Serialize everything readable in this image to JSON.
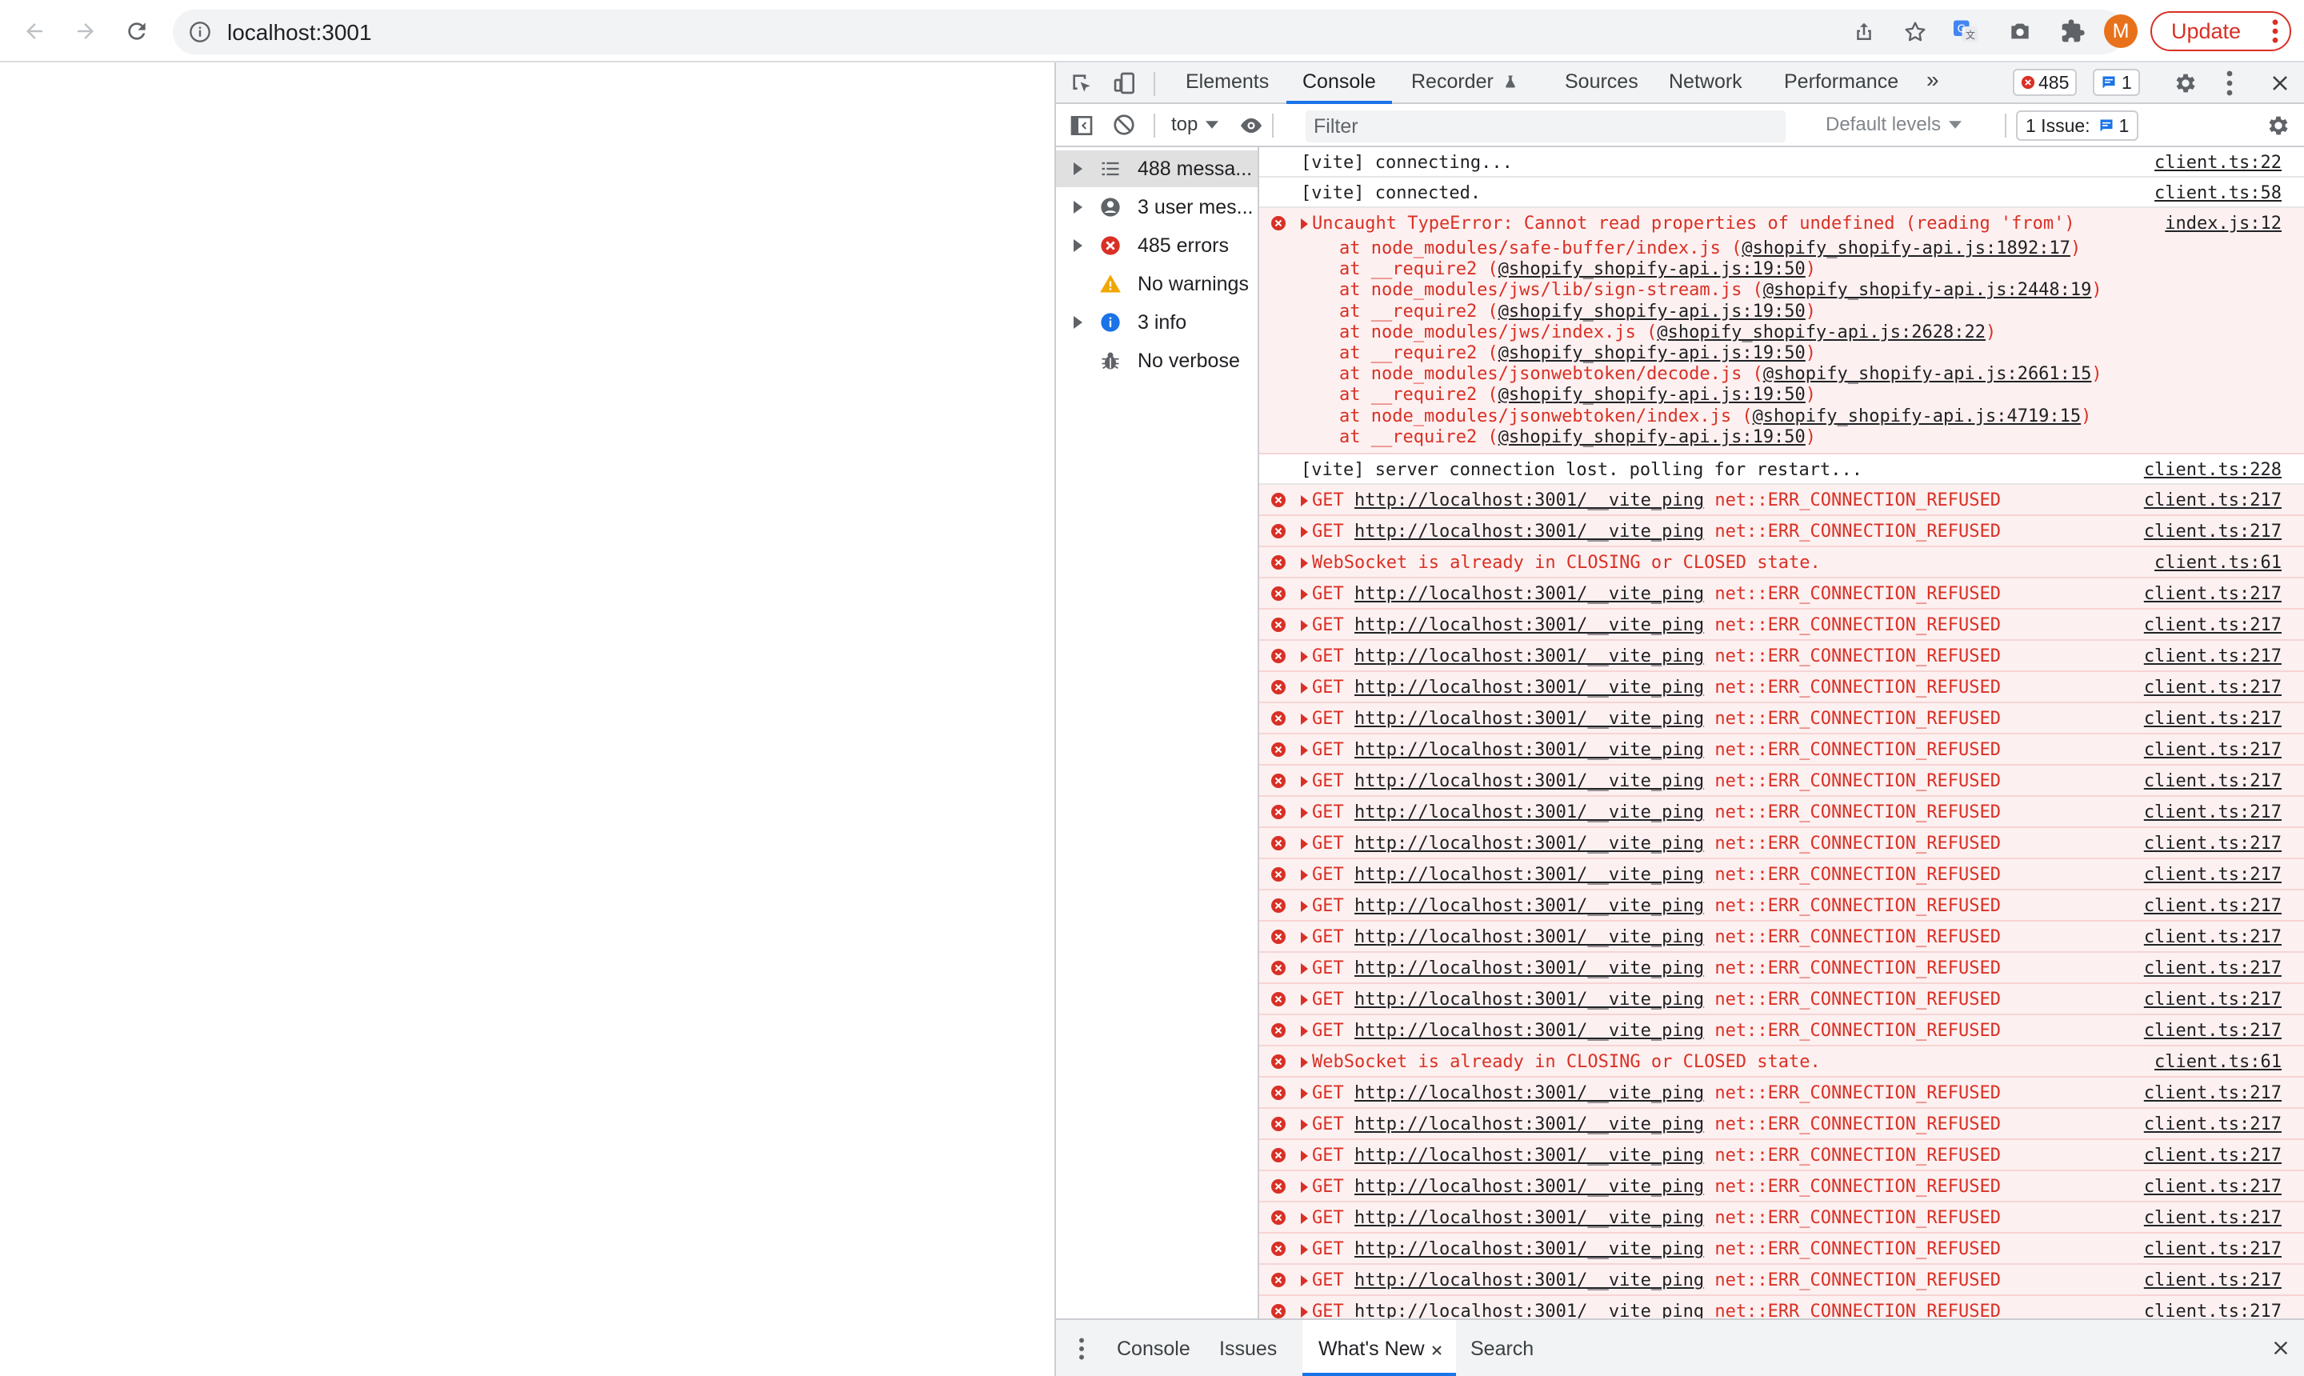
{
  "browser": {
    "url": "localhost:3001",
    "avatar_letter": "M",
    "update_label": "Update"
  },
  "devtools": {
    "tabs": [
      "Elements",
      "Console",
      "Recorder",
      "Sources",
      "Network",
      "Performance"
    ],
    "active_tab": "Console",
    "error_count": "485",
    "message_count": "1",
    "filter": {
      "context": "top",
      "placeholder": "Filter",
      "levels": "Default levels",
      "issues_label": "1 Issue:",
      "issues_count": "1"
    },
    "sidebar": [
      {
        "label": "488 messa...",
        "icon": "list-icon",
        "expandable": true
      },
      {
        "label": "3 user mes...",
        "icon": "user-icon",
        "expandable": true
      },
      {
        "label": "485 errors",
        "icon": "error-icon",
        "expandable": true
      },
      {
        "label": "No warnings",
        "icon": "warning-icon",
        "expandable": false
      },
      {
        "label": "3 info",
        "icon": "info-icon",
        "expandable": true
      },
      {
        "label": "No verbose",
        "icon": "bug-icon",
        "expandable": false
      }
    ],
    "console": {
      "msg_connecting": {
        "text": "[vite] connecting...",
        "source": "client.ts:22"
      },
      "msg_connected": {
        "text": "[vite] connected.",
        "source": "client.ts:58"
      },
      "type_error": {
        "text": "Uncaught TypeError: Cannot read properties of undefined (reading 'from')",
        "source": "index.js:12",
        "stack": [
          {
            "at": "at node_modules/safe-buffer/index.js (",
            "link": "@shopify_shopify-api.js:1892:17",
            "end": ")"
          },
          {
            "at": "at __require2 (",
            "link": "@shopify_shopify-api.js:19:50",
            "end": ")"
          },
          {
            "at": "at node_modules/jws/lib/sign-stream.js (",
            "link": "@shopify_shopify-api.js:2448:19",
            "end": ")"
          },
          {
            "at": "at __require2 (",
            "link": "@shopify_shopify-api.js:19:50",
            "end": ")"
          },
          {
            "at": "at node_modules/jws/index.js (",
            "link": "@shopify_shopify-api.js:2628:22",
            "end": ")"
          },
          {
            "at": "at __require2 (",
            "link": "@shopify_shopify-api.js:19:50",
            "end": ")"
          },
          {
            "at": "at node_modules/jsonwebtoken/decode.js (",
            "link": "@shopify_shopify-api.js:2661:15",
            "end": ")"
          },
          {
            "at": "at __require2 (",
            "link": "@shopify_shopify-api.js:19:50",
            "end": ")"
          },
          {
            "at": "at node_modules/jsonwebtoken/index.js (",
            "link": "@shopify_shopify-api.js:4719:15",
            "end": ")"
          },
          {
            "at": "at __require2 (",
            "link": "@shopify_shopify-api.js:19:50",
            "end": ")"
          }
        ]
      },
      "msg_lost": {
        "text": "[vite] server connection lost. polling for restart...",
        "source": "client.ts:228"
      },
      "get_row": {
        "method": "GET",
        "url": "http://localhost:3001/__vite_ping",
        "status": "net::ERR_CONNECTION_REFUSED",
        "source": "client.ts:217"
      },
      "ws_row": {
        "text": "WebSocket is already in CLOSING or CLOSED state.",
        "source": "client.ts:61"
      },
      "rows": [
        "get",
        "get",
        "ws",
        "get",
        "get",
        "get",
        "get",
        "get",
        "get",
        "get",
        "get",
        "get",
        "get",
        "get",
        "get",
        "get",
        "get",
        "get",
        "ws",
        "get",
        "get",
        "get",
        "get",
        "get",
        "get",
        "get",
        "get",
        "get"
      ]
    },
    "drawer": {
      "tabs": [
        "Console",
        "Issues",
        "What's New",
        "Search"
      ],
      "active_tab": "What's New"
    }
  },
  "colors": {
    "error_red": "#d93025",
    "accent_blue": "#1a73e8",
    "error_bg": "#fdf0f0"
  }
}
